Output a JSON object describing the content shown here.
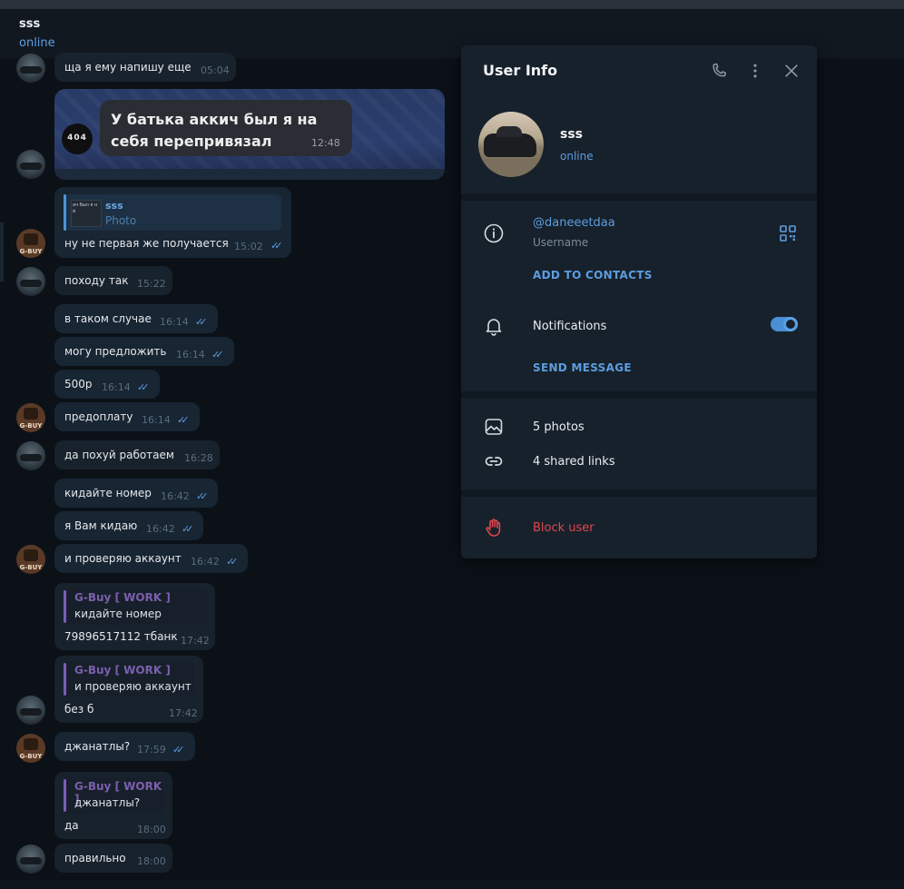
{
  "header": {
    "title": "sss",
    "status": "online"
  },
  "messages": {
    "m1": {
      "text": "ща я ему напишу еще",
      "time": "05:04"
    },
    "sticker": {
      "text": "У батька аккич был я на себя перепривязал",
      "time": "12:48",
      "logo": "404"
    },
    "m2": {
      "reply_name": "sss",
      "reply_text": "Photo",
      "thumb_text": "ач был я н й",
      "text": "ну не первая же получается",
      "time": "15:02"
    },
    "m3": {
      "text": "походу так",
      "time": "15:22"
    },
    "m4": {
      "text": "в таком случае",
      "time": "16:14"
    },
    "m5": {
      "text": "могу предложить",
      "time": "16:14"
    },
    "m6": {
      "text": "500р",
      "time": "16:14"
    },
    "m7": {
      "text": "предоплату",
      "time": "16:14"
    },
    "m8": {
      "text": "да похуй работаем",
      "time": "16:28"
    },
    "m9": {
      "text": "кидайте номер",
      "time": "16:42"
    },
    "m10": {
      "text": "я Вам кидаю",
      "time": "16:42"
    },
    "m11": {
      "text": "и проверяю аккаунт",
      "time": "16:42"
    },
    "m12": {
      "reply_name": "G-Buy [ WORK ]",
      "reply_text": "кидайте номер",
      "text": "79896517112 тбанк",
      "time": "17:42"
    },
    "m13": {
      "reply_name": "G-Buy [ WORK ]",
      "reply_text": "и проверяю аккаунт",
      "text": "без б",
      "time": "17:42"
    },
    "m14": {
      "text": "джанатлы?",
      "time": "17:59"
    },
    "m15": {
      "reply_name": "G-Buy [ WORK ]",
      "reply_text": "джанатлы?",
      "text": "да",
      "time": "18:00"
    },
    "m16": {
      "text": "правильно",
      "time": "18:00"
    }
  },
  "avatar_tank_text": "G-BUY",
  "panel": {
    "title": "User Info",
    "name": "sss",
    "status": "online",
    "username": "@daneeetdaa",
    "username_label": "Username",
    "add_contacts": "ADD TO CONTACTS",
    "notifications": "Notifications",
    "notifications_on": true,
    "send_message": "SEND MESSAGE",
    "photos": "5 photos",
    "shared_links": "4 shared links",
    "block": "Block user"
  },
  "colors": {
    "accent": "#5d9de0",
    "danger": "#e0464e",
    "reply_name": "#7b5fae",
    "panel_bg": "#17212b"
  }
}
